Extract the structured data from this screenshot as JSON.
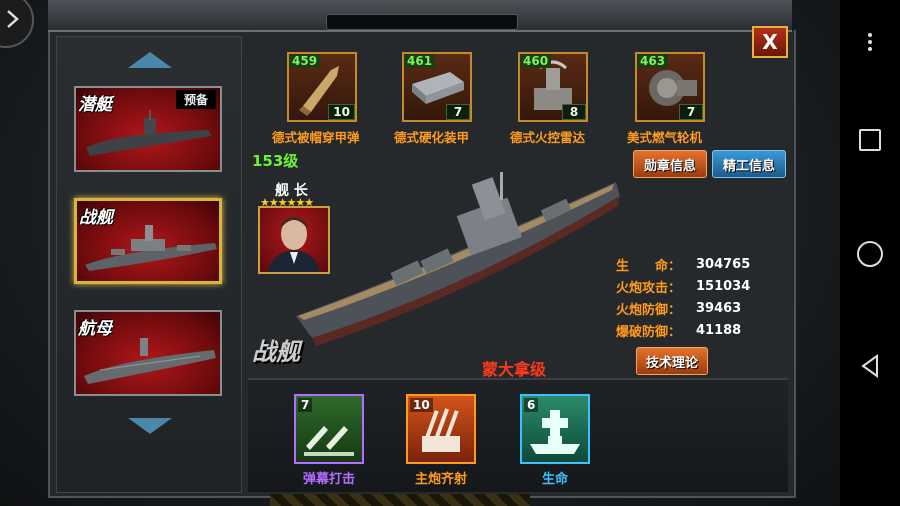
{
  "equipment": [
    {
      "level": "459",
      "count": "10",
      "name": "德式被帽穿甲弹",
      "icon": "armor-piercing-shell-icon"
    },
    {
      "level": "461",
      "count": "7",
      "name": "德式硬化装甲",
      "icon": "hardened-armor-icon"
    },
    {
      "level": "460",
      "count": "8",
      "name": "德式火控雷达",
      "icon": "fire-control-radar-icon"
    },
    {
      "level": "463",
      "count": "7",
      "name": "美式燃气轮机",
      "icon": "gas-turbine-icon"
    }
  ],
  "ship_list": [
    {
      "type": "潜艇",
      "badge": "预备"
    },
    {
      "type": "战舰",
      "badge": ""
    },
    {
      "type": "航母",
      "badge": ""
    }
  ],
  "ship": {
    "level": "153级",
    "name": "蒙大拿级",
    "type_mark": "战舰",
    "captain_label": "舰 长",
    "captain_stars": "★★★★★★"
  },
  "buttons": {
    "medal_info": "勋章信息",
    "elite_info": "精工信息",
    "tech_theory": "技术理论",
    "close": "X"
  },
  "stats": [
    {
      "label": "生　　命：",
      "value": "304765"
    },
    {
      "label": "火炮攻击：",
      "value": "151034"
    },
    {
      "label": "火炮防御：",
      "value": "39463"
    },
    {
      "label": "爆破防御：",
      "value": "41188"
    }
  ],
  "skills": [
    {
      "level": "7",
      "name": "弹幕打击",
      "color": "#b56cff"
    },
    {
      "level": "10",
      "name": "主炮齐射",
      "color": "#ff9a1e"
    },
    {
      "level": "6",
      "name": "生命",
      "color": "#3ec0ff"
    }
  ]
}
